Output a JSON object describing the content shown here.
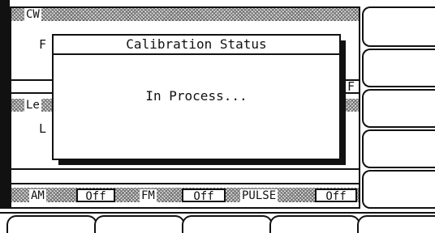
{
  "panels": {
    "cw": {
      "title": "CW",
      "field_fragment": "F"
    },
    "level": {
      "title": "Le",
      "field_fragment": "L"
    },
    "right_fragment": "F"
  },
  "dialog": {
    "title": "Calibration Status",
    "message": "In Process..."
  },
  "annunciators": [
    {
      "label": "AM",
      "state": "Off"
    },
    {
      "label": "FM",
      "state": "Off"
    },
    {
      "label": "PULSE",
      "state": "Off"
    }
  ]
}
